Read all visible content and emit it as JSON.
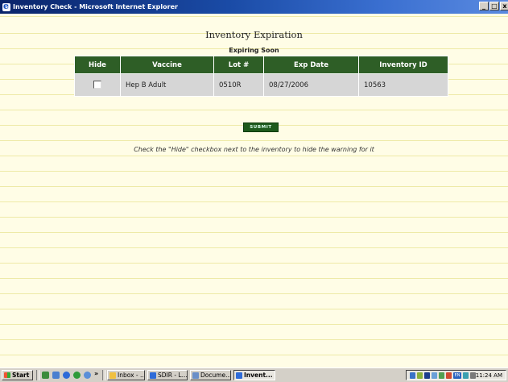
{
  "window": {
    "title": "Inventory Check - Microsoft Internet Explorer",
    "minimize": "_",
    "maximize": "□",
    "close": "x"
  },
  "page": {
    "title": "Inventory Expiration",
    "subtitle": "Expiring Soon",
    "table": {
      "headers": [
        "Hide",
        "Vaccine",
        "Lot #",
        "Exp Date",
        "Inventory ID"
      ],
      "rows": [
        {
          "hide_checked": false,
          "vaccine": "Hep B Adult",
          "lot": "0510R",
          "exp_date": "08/27/2006",
          "inventory_id": "10563"
        }
      ]
    },
    "submit_label": "SUBMIT",
    "note": "Check the \"Hide\" checkbox next to the inventory to hide the warning for it"
  },
  "taskbar": {
    "start_label": "Start",
    "more_label": "»",
    "tasks": [
      {
        "label": "Inbox - ...",
        "icon": "mail-icon",
        "active": false
      },
      {
        "label": "SDIR - L...",
        "icon": "ie-icon",
        "active": false
      },
      {
        "label": "Docume...",
        "icon": "document-icon",
        "active": false
      },
      {
        "label": "Invent...",
        "icon": "ie-icon",
        "active": true
      }
    ],
    "tray_lang": "EN",
    "clock": "11:24 AM"
  },
  "colors": {
    "header_green": "#2e5e26",
    "page_bg": "#fffde6",
    "rule_line": "#eeeaa7",
    "cell_gray": "#d6d6d6",
    "titlebar_blue": "#0a246a"
  }
}
